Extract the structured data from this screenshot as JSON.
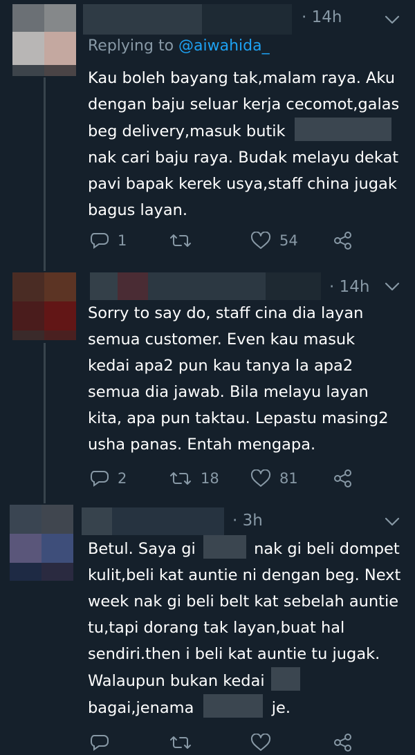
{
  "tweets": [
    {
      "time": "14h",
      "replying_prefix": "Replying to ",
      "replying_handle": "@aiwahida_",
      "text_lines": [
        "Kau boleh bayang tak,malam raya. Aku",
        "dengan baju seluar kerja cecomot,galas",
        "beg delivery,masuk butik",
        "nak cari baju raya. Budak melayu dekat",
        "pavi bapak kerek usya,staff china jugak",
        "bagus layan."
      ],
      "replies": "1",
      "retweets": "",
      "likes": "54"
    },
    {
      "time": "14h",
      "text_lines": [
        "Sorry to say do, staff cina dia layan",
        "semua customer. Even kau masuk",
        "kedai apa2 pun kau tanya la apa2",
        "semua dia jawab. Bila melayu layan",
        "kita, apa pun taktau. Lepastu masing2",
        "usha panas. Entah mengapa."
      ],
      "replies": "2",
      "retweets": "18",
      "likes": "81"
    },
    {
      "time": "3h",
      "text_lines": [
        "Betul. Saya gi",
        "nak gi beli dompet",
        "kulit,beli kat auntie ni dengan beg. Next",
        "week nak gi beli belt kat sebelah auntie",
        "tu,tapi dorang tak layan,buat hal",
        "sendiri.then i beli kat auntie tu jugak.",
        "Walaupun bukan kedai",
        "bagai,jenama",
        "je."
      ]
    }
  ],
  "icons": {
    "reply": "reply-icon",
    "retweet": "retweet-icon",
    "like": "heart-icon",
    "share": "share-icon",
    "more": "chevron-down-icon"
  },
  "colors": {
    "background": "#15202b",
    "muted": "#8899a6",
    "accent": "#1da1f2",
    "line": "#38444d"
  }
}
